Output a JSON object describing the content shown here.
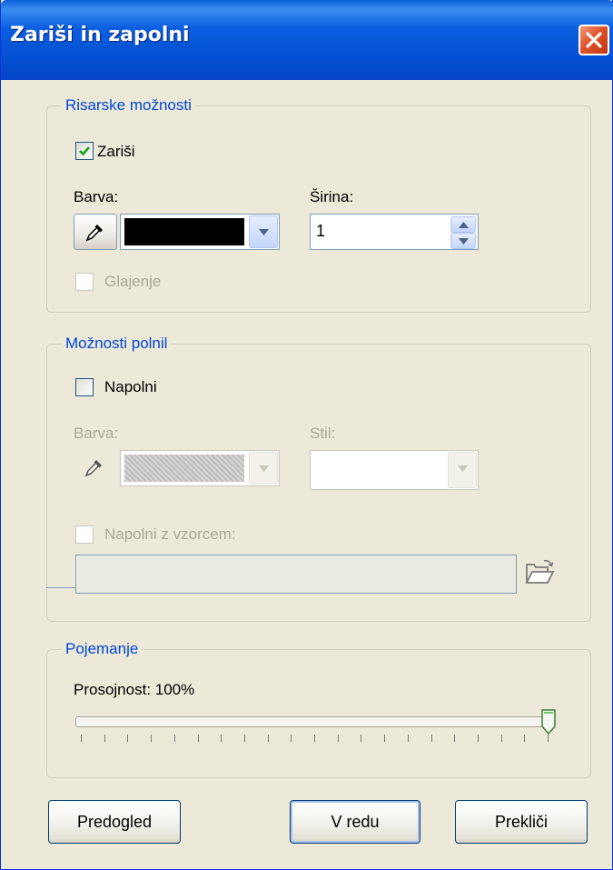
{
  "window": {
    "title": "Zariši in zapolni"
  },
  "drawing": {
    "legend": "Risarske možnosti",
    "outline_label": "Zariši",
    "outline_checked": true,
    "color_label": "Barva:",
    "color_value": "#000000",
    "width_label": "Širina:",
    "width_value": "1",
    "antialias_label": "Glajenje"
  },
  "fill": {
    "legend": "Možnosti polnil",
    "fill_label": "Napolni",
    "fill_checked": false,
    "color_label": "Barva:",
    "style_label": "Stil:",
    "pattern_label": "Napolni z vzorcem:",
    "pattern_path": ""
  },
  "blend": {
    "legend": "Pojemanje",
    "opacity_text": "Prosojnost: 100%",
    "opacity_value": 100
  },
  "buttons": {
    "preview": "Predogled",
    "ok": "V redu",
    "cancel": "Prekliči"
  }
}
